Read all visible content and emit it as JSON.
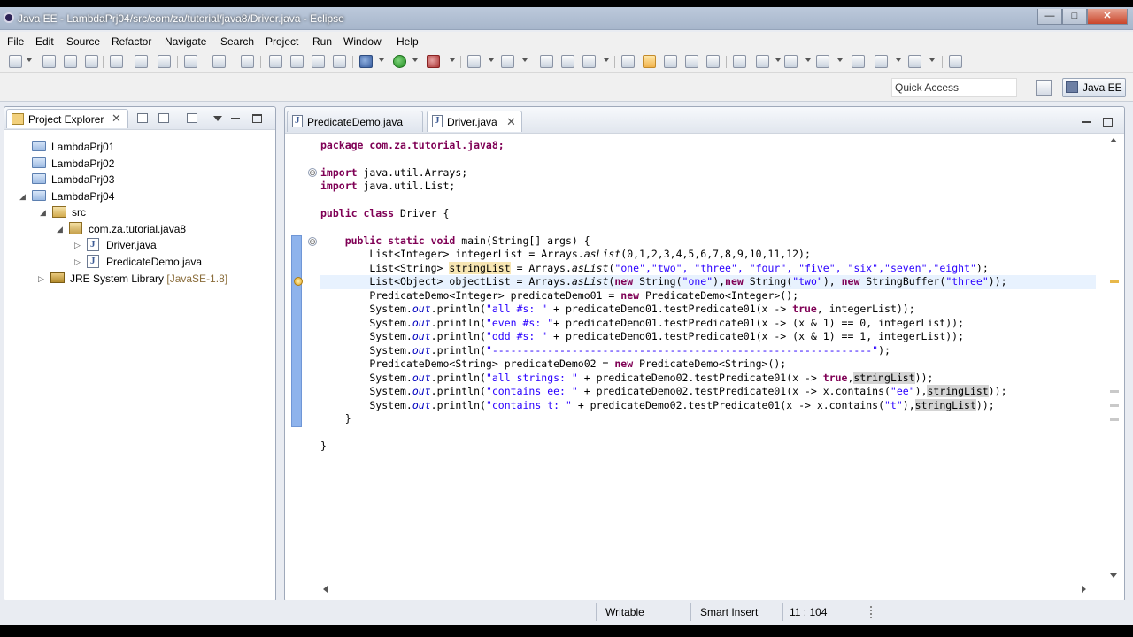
{
  "window": {
    "title": "Java EE - LambdaPrj04/src/com/za/tutorial/java8/Driver.java - Eclipse",
    "controls": {
      "minimize": "—",
      "maximize": "□",
      "close": "✕"
    }
  },
  "menu": [
    "File",
    "Edit",
    "Source",
    "Refactor",
    "Navigate",
    "Search",
    "Project",
    "Run",
    "Window",
    "Help"
  ],
  "toolbar": {
    "quick_access": "Quick Access",
    "perspective": "Java EE"
  },
  "explorer": {
    "title": "Project Explorer",
    "close": "✕",
    "tree": [
      {
        "label": "LambdaPrj01"
      },
      {
        "label": "LambdaPrj02"
      },
      {
        "label": "LambdaPrj03"
      },
      {
        "label": "LambdaPrj04",
        "expanded": true
      },
      {
        "label": "src",
        "expanded": true
      },
      {
        "label": "com.za.tutorial.java8",
        "expanded": true
      },
      {
        "label": "Driver.java",
        "selected": true
      },
      {
        "label": "PredicateDemo.java"
      },
      {
        "label": "JRE System Library",
        "extra": "[JavaSE-1.8]"
      }
    ]
  },
  "editor": {
    "tabs": [
      {
        "label": "PredicateDemo.java",
        "active": false
      },
      {
        "label": "Driver.java",
        "active": true,
        "close": "✕"
      }
    ],
    "fold_markers": [
      "⊖",
      "⊖"
    ],
    "code": {
      "l1": "package com.za.tutorial.java8;",
      "l2a": "import",
      "l2b": " java.util.Arrays;",
      "l3a": "import",
      "l3b": " java.util.List;",
      "l4a": "public class",
      "l4b": " Driver {",
      "l5a": "    public static void",
      "l5b": " main(String[] args) {",
      "l6a": "        List<Integer> integerList = Arrays.",
      "l6b": "asList",
      "l6c": "(0,1,2,3,4,5,6,7,8,9,10,11,12);",
      "l7a": "        List<String> ",
      "l7b": "stringList",
      "l7c": " = Arrays.",
      "l7d": "asList",
      "l7e": "(",
      "l7f": "\"one\",\"two\", \"three\", \"four\", \"five\", \"six\",\"seven\",\"eight\"",
      "l7g": ");",
      "l8a": "        List<Object> objectList = Arrays.",
      "l8b": "asList",
      "l8c": "(",
      "l8d": "new",
      "l8e": " String(",
      "l8f": "\"one\"",
      "l8g": "),",
      "l8h": "new",
      "l8i": " String(",
      "l8j": "\"two\"",
      "l8k": "), ",
      "l8l": "new",
      "l8m": " StringBuffer(",
      "l8n": "\"three\"",
      "l8o": "));",
      "l9a": "        PredicateDemo<Integer> predicateDemo01 = ",
      "l9b": "new",
      "l9c": " PredicateDemo<Integer>();",
      "l10a": "        System.",
      "l10b": "out",
      "l10c": ".println(",
      "l10d": "\"all #s: \"",
      "l10e": " + predicateDemo01.testPredicate01(x -> ",
      "l10f": "true",
      "l10g": ", integerList));",
      "l11a": "        System.",
      "l11b": "out",
      "l11c": ".println(",
      "l11d": "\"even #s: \"",
      "l11e": "+ predicateDemo01.testPredicate01(x -> (x & 1) == 0, integerList));",
      "l12a": "        System.",
      "l12b": "out",
      "l12c": ".println(",
      "l12d": "\"odd #s: \"",
      "l12e": " + predicateDemo01.testPredicate01(x -> (x & 1) == 1, integerList));",
      "l13a": "        System.",
      "l13b": "out",
      "l13c": ".println(",
      "l13d": "\"--------------------------------------------------------------\"",
      "l13e": ");",
      "l14a": "        PredicateDemo<String> predicateDemo02 = ",
      "l14b": "new",
      "l14c": " PredicateDemo<String>();",
      "l15a": "        System.",
      "l15b": "out",
      "l15c": ".println(",
      "l15d": "\"all strings: \"",
      "l15e": " + predicateDemo02.testPredicate01(x -> ",
      "l15f": "true",
      "l15g": ",",
      "l15h": "stringList",
      "l15i": "));",
      "l16a": "        System.",
      "l16b": "out",
      "l16c": ".println(",
      "l16d": "\"contains ee: \"",
      "l16e": " + predicateDemo02.testPredicate01(x -> x.contains(",
      "l16f": "\"ee\"",
      "l16g": "),",
      "l16h": "stringList",
      "l16i": "));",
      "l17a": "        System.",
      "l17b": "out",
      "l17c": ".println(",
      "l17d": "\"contains t: \"",
      "l17e": " + predicateDemo02.testPredicate01(x -> x.contains(",
      "l17f": "\"t\"",
      "l17g": "),",
      "l17h": "stringList",
      "l17i": "));",
      "l18": "    }",
      "l19": "}"
    }
  },
  "status": {
    "mode": "Writable",
    "insert": "Smart Insert",
    "position": "11 : 104"
  }
}
